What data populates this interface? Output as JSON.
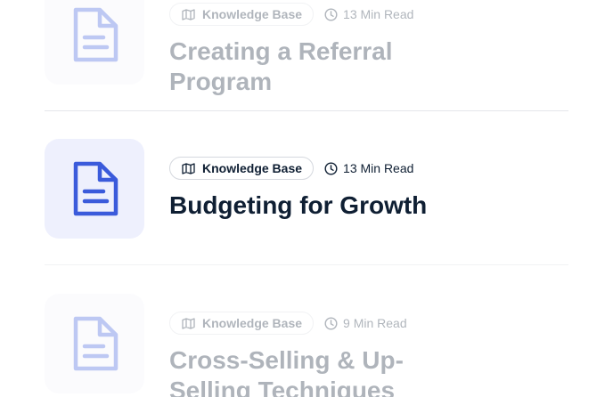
{
  "articles": [
    {
      "icon": "document-icon",
      "category": "Knowledge Base",
      "category_icon": "map-icon",
      "read_time": "13 Min Read",
      "title": "Creating a Referral Program",
      "state": "faded"
    },
    {
      "icon": "document-icon",
      "category": "Knowledge Base",
      "category_icon": "map-icon",
      "read_time": "13 Min Read",
      "title": "Budgeting for Growth",
      "state": "active"
    },
    {
      "icon": "document-icon",
      "category": "Knowledge Base",
      "category_icon": "map-icon",
      "read_time": "9 Min Read",
      "title": "Cross-Selling & Up-Selling Techniques",
      "state": "faded"
    }
  ],
  "colors": {
    "accent": "#3b5bdb",
    "thumb_bg": "#eef0fd",
    "text": "#0f1f33",
    "badge_border": "#d5d8de",
    "divider": "#e4e6ea"
  }
}
